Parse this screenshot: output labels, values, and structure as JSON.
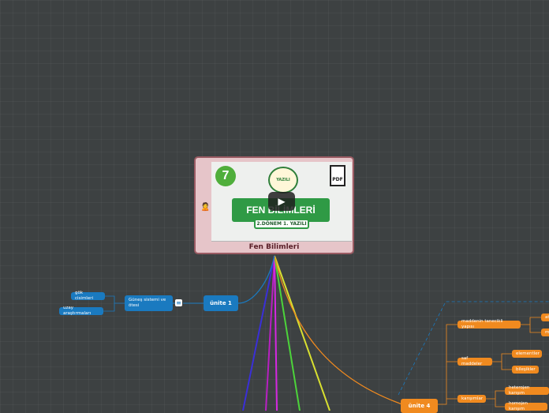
{
  "root": {
    "title": "Fen Bilimleri",
    "emoji": "🙎",
    "thumbnail": {
      "badge": "7",
      "stamp": "YAZILI",
      "pdf_label": "PDF",
      "banner": "FEN BİLİMLERİ",
      "subtitle": "2.DÖNEM 1. YAZILI",
      "play_icon": "play-icon"
    }
  },
  "unite1": {
    "label": "ünite 1",
    "child": "Güneş sistemi ve ötesi",
    "leaves": [
      "gök cisimleri",
      "uzay araştırmaları"
    ]
  },
  "unite4": {
    "label": "ünite 4",
    "children": [
      {
        "label": "maddenin tanecikli yapısı",
        "leaves": [
          "at",
          "m"
        ]
      },
      {
        "label": "saf maddeler",
        "leaves": [
          "elementler",
          "bileşikler"
        ]
      },
      {
        "label": "karışımlar",
        "leaves": [
          "heterojen karışım",
          "homojen karışım"
        ]
      }
    ]
  },
  "colors": {
    "background": "#3d4142",
    "unite1": "#1a7ac0",
    "unite4": "#f08a1f",
    "branches": [
      "#3a2fd8",
      "#c020c8",
      "#d324e0",
      "#4cd43a",
      "#d8e030"
    ]
  }
}
